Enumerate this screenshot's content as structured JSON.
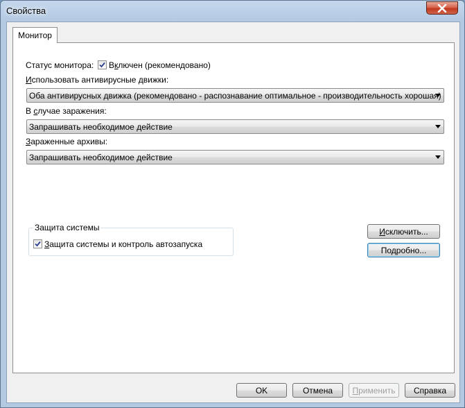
{
  "window": {
    "title": "Свойства"
  },
  "tabs": [
    {
      "label": "Монитор"
    }
  ],
  "monitor": {
    "status_label": "Статус монитора:",
    "status_checkbox": {
      "pre": "В",
      "key": "к",
      "post": "лючен (рекомендовано)",
      "checked": true
    },
    "engines_label": {
      "pre": "",
      "key": "И",
      "post": "спользовать антивирусные движки:"
    },
    "engines_value": "Оба антивирусных движка (рекомендовано - распознавание оптимальное - производительность хорошая)",
    "infection_label": {
      "pre": "В ",
      "key": "с",
      "post": "лучае заражения:"
    },
    "infection_value": "Запрашивать необходимое действие",
    "archives_label": {
      "pre": "",
      "key": "З",
      "post": "араженные архивы:"
    },
    "archives_value": "Запрашивать необходимое действие"
  },
  "system_protection": {
    "group_title": "Защита системы",
    "checkbox": {
      "pre": "",
      "key": "З",
      "post": "ащита системы и контроль автозапуска",
      "checked": true
    }
  },
  "side_buttons": {
    "exclude": {
      "pre": "",
      "key": "И",
      "post": "сключить..."
    },
    "details": {
      "pre": "По",
      "key": "д",
      "post": "робно..."
    }
  },
  "footer": {
    "ok": "OK",
    "cancel": "Отмена",
    "apply": {
      "pre": "",
      "key": "П",
      "post": "рименить"
    },
    "help": "Справка"
  }
}
